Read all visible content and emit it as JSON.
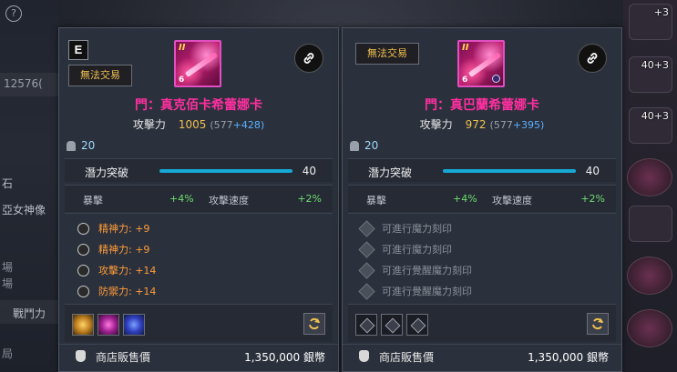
{
  "background": {
    "help_icon": "?",
    "left_texts": [
      "12576(",
      "石",
      "亞女神像",
      "場",
      "場",
      "戰鬥力",
      "局"
    ]
  },
  "sidebar_right": {
    "slots": [
      {
        "level": "+3"
      },
      {
        "level": "40+3"
      },
      {
        "level": "40+3"
      },
      {
        "level": ""
      },
      {
        "level": ""
      }
    ]
  },
  "panels": [
    {
      "grade": "E",
      "trade_status": "無法交易",
      "icon": {
        "tier": "II",
        "level": "6",
        "name": "item-icon"
      },
      "name": "門：真克佰卡希蕾娜卡",
      "attack_label": "攻擊力",
      "attack_value": "1005",
      "attack_base": "(577",
      "attack_bonus": "+428)",
      "upgrade_count": "20",
      "potential_label": "潛力突破",
      "potential_value": "40",
      "potential_fill": 1.0,
      "stat1_label": "暴擊",
      "stat1_value": "+4%",
      "stat2_label": "攻擊速度",
      "stat2_value": "+2%",
      "engravings": [
        {
          "text": "精神力: +9",
          "color": "orange"
        },
        {
          "text": "精神力: +9",
          "color": "orange"
        },
        {
          "text": "攻擊力: +14",
          "color": "orange"
        },
        {
          "text": "防禦力: +14",
          "color": "orange"
        }
      ],
      "gems": [
        "gold",
        "pink",
        "blue"
      ],
      "price_label": "商店販售價",
      "price_value": "1,350,000 銀幣"
    },
    {
      "grade": "",
      "trade_status": "無法交易",
      "icon": {
        "tier": "II",
        "level": "6",
        "name": "item-icon"
      },
      "name": "門：真巴蘭希蕾娜卡",
      "attack_label": "攻擊力",
      "attack_value": "972",
      "attack_base": "(577",
      "attack_bonus": "+395)",
      "upgrade_count": "20",
      "potential_label": "潛力突破",
      "potential_value": "40",
      "potential_fill": 1.0,
      "stat1_label": "暴擊",
      "stat1_value": "+4%",
      "stat2_label": "攻擊速度",
      "stat2_value": "+2%",
      "engravings": [
        {
          "text": "可進行魔力刻印",
          "color": "grey"
        },
        {
          "text": "可進行魔力刻印",
          "color": "grey"
        },
        {
          "text": "可進行覺醒魔力刻印",
          "color": "grey"
        },
        {
          "text": "可進行覺醒魔力刻印",
          "color": "grey"
        }
      ],
      "gems": [
        "empty",
        "empty",
        "empty"
      ],
      "price_label": "商店販售價",
      "price_value": "1,350,000 銀幣"
    }
  ],
  "colors": {
    "item_name": "#ff2fa0",
    "attack_value": "#f0c050",
    "attack_bonus": "#5ab0ff",
    "stat_value": "#6fdc6f",
    "engraving_active": "#ff9b3a",
    "engraving_empty": "#8a909a",
    "potential_bar": "#16a9d6"
  }
}
